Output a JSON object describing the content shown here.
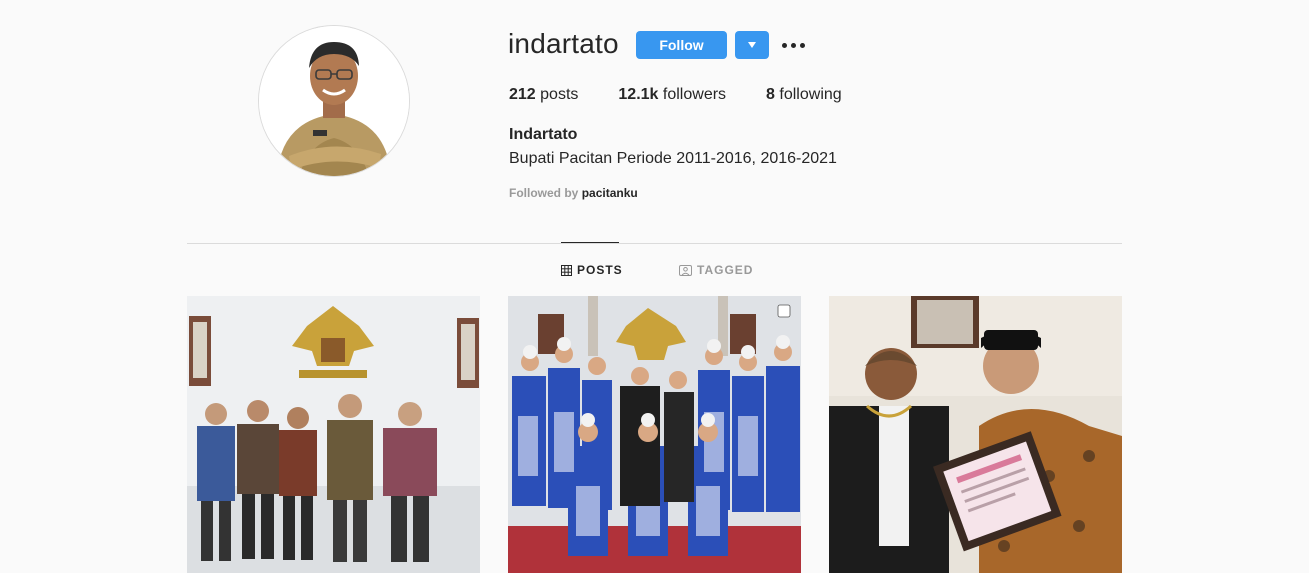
{
  "profile": {
    "username": "indartato",
    "follow_label": "Follow",
    "full_name": "Indartato",
    "bio": "Bupati Pacitan Periode 2011-2016, 2016-2021",
    "followed_by_prefix": "Followed by",
    "followed_by_user": "pacitanku"
  },
  "stats": {
    "posts_count": "212",
    "posts_label": "posts",
    "followers_count": "12.1k",
    "followers_label": "followers",
    "following_count": "8",
    "following_label": "following"
  },
  "tabs": {
    "posts": "POSTS",
    "tagged": "TAGGED"
  },
  "colors": {
    "accent": "#3897f0",
    "text": "#262626",
    "muted": "#999999",
    "background": "#fafafa",
    "border": "#dbdbdb"
  },
  "icons": {
    "posts_tab": "grid-icon",
    "tagged_tab": "tagged-icon",
    "more": "ellipsis-icon",
    "dropdown": "caret-down-icon",
    "carousel": "multiple-photos-icon"
  }
}
